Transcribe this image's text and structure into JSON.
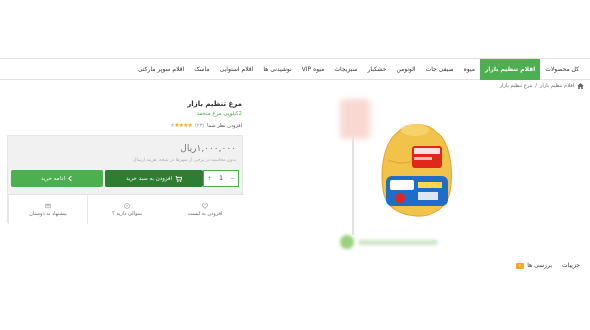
{
  "nav": {
    "items": [
      {
        "label": "کل محصولات",
        "active": false
      },
      {
        "label": "اقلام تنظیم بازار",
        "active": true
      },
      {
        "label": "میوه",
        "active": false
      },
      {
        "label": "صیفی جات",
        "active": false
      },
      {
        "label": "الونومن",
        "active": false
      },
      {
        "label": "خشکبار",
        "active": false
      },
      {
        "label": "سبزیجات",
        "active": false
      },
      {
        "label": "میوه VIP",
        "active": false
      },
      {
        "label": "نوشیدنی ها",
        "active": false
      },
      {
        "label": "اقلام استوایی",
        "active": false
      },
      {
        "label": "ماسک",
        "active": false
      },
      {
        "label": "اقلام سوپر مارکتی",
        "active": false
      }
    ]
  },
  "breadcrumb": {
    "items": [
      "اقلام تنظیم بازار",
      "مرغ تنظیم بازار"
    ],
    "separator": "/"
  },
  "product": {
    "title": "مرغ تنظیم بازار",
    "subtitle": "2کیلویی مرغ منجمد",
    "rating": 4,
    "rating_count": "(۲۳)",
    "add_review": "افزودن نظر شما",
    "price": "۱,۰۰۰,۰۰۰ریال",
    "shipping_note": "بدون محاسبه در برخی از شهرها در نتیجه: هزینه ارسال",
    "quantity": "1",
    "qty_plus": "+",
    "qty_minus": "−",
    "cart_button": "افزودن به سبد خرید",
    "continue_button": "ادامه خرید",
    "actions": {
      "compare": "افزودن به لیست",
      "question": "سوالی دارید ؟",
      "share": "پیشنهاد به دوستان"
    }
  },
  "tabs": {
    "details": "جزییات",
    "reviews": "بررسی ها",
    "reviews_badge": "۲"
  },
  "colors": {
    "accent": "#4caf50",
    "cart": "#2e7d32",
    "star": "#f5a623"
  },
  "icons": {
    "home": "home-icon",
    "cart": "cart-icon",
    "heart": "heart-icon",
    "question": "question-icon",
    "share": "share-icon"
  }
}
